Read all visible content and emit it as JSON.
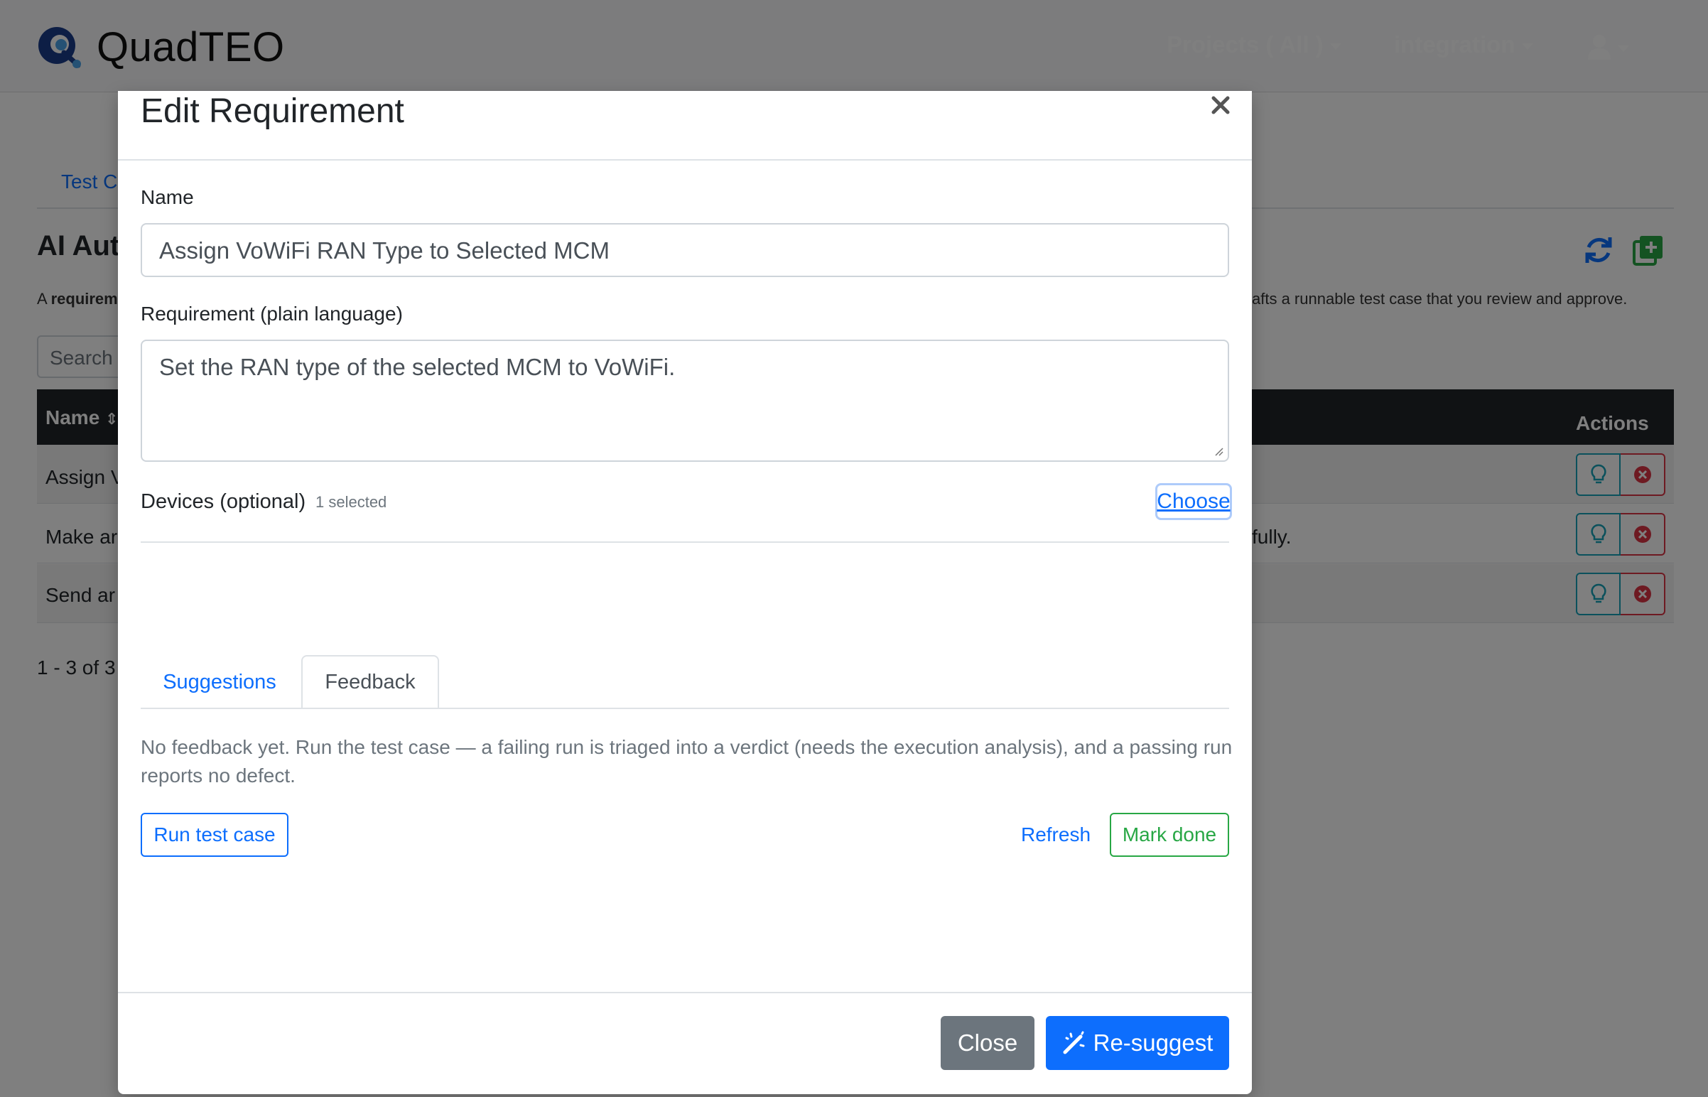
{
  "navbar": {
    "brand": "QuadTEO",
    "projects_label": "Projects ( All )",
    "environment_label": "integration"
  },
  "background": {
    "tab_label": "Test C",
    "page_title": "AI Aut",
    "description_left_prefix": "A ",
    "description_left_bold": "requirem",
    "description_right": "afts a runnable test case that you review and approve.",
    "search_placeholder": "Search",
    "table": {
      "name_header": "Name",
      "actions_header": "Actions",
      "rows": [
        {
          "name": "Assign V",
          "right": ""
        },
        {
          "name": "Make ar",
          "right": "fully."
        },
        {
          "name": "Send ar",
          "right": ""
        }
      ]
    },
    "pagination": "1 - 3 of 3"
  },
  "modal": {
    "title": "Edit Requirement",
    "name_label": "Name",
    "name_value": "Assign VoWiFi RAN Type to Selected MCM",
    "requirement_label": "Requirement (plain language)",
    "requirement_value": "Set the RAN type of the selected MCM to VoWiFi.",
    "devices_label": "Devices (optional)",
    "devices_count": "1 selected",
    "choose_label": "Choose",
    "tabs": [
      {
        "label": "Suggestions",
        "active": false
      },
      {
        "label": "Feedback",
        "active": true
      }
    ],
    "feedback_text": "No feedback yet. Run the test case — a failing run is triaged into a verdict (needs the execution analysis), and a passing run reports no defect.",
    "run_label": "Run test case",
    "refresh_label": "Refresh",
    "mark_done_label": "Mark done",
    "close_label": "Close",
    "resuggest_label": "Re-suggest"
  },
  "colors": {
    "primary": "#0d6efd",
    "success": "#28a745",
    "secondary": "#6c757d",
    "danger": "#dc3545",
    "info": "#17a2b8",
    "table_header": "#212529"
  },
  "icons": [
    "brand-logo-icon",
    "caret-down-icon",
    "user-icon",
    "refresh-icon",
    "add-icon",
    "lightbulb-icon",
    "delete-icon",
    "close-icon",
    "magic-wand-icon",
    "sort-icon"
  ]
}
